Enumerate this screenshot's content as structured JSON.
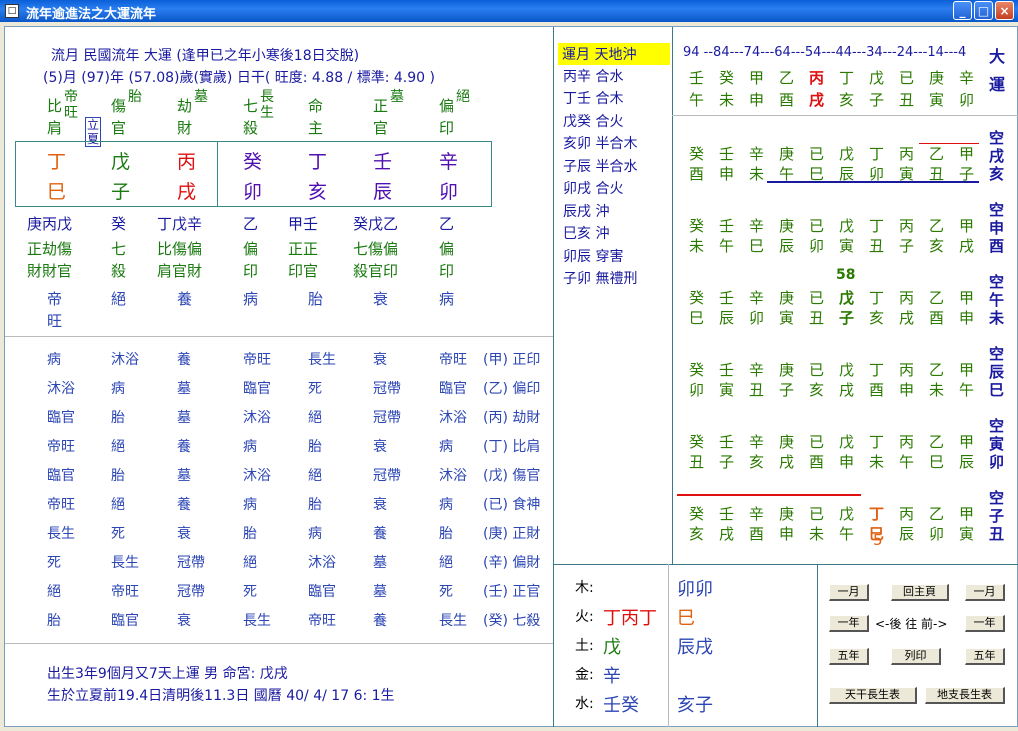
{
  "window": {
    "title": "流年逾進法之大運流年"
  },
  "header": {
    "line1": "流月  民國流年    大運   (逢甲已之年小寒後18日交脫)",
    "line2": "(5)月    (97)年    (57.08)歲(實歲)       日干( 旺度: 4.88 / 標準: 4.90 )"
  },
  "gods": [
    {
      "a": "比",
      "b": "肩",
      "c": "帝旺"
    },
    {
      "a": "傷",
      "b": "官",
      "c": "胎"
    },
    {
      "a": "劫",
      "b": "財",
      "c": "墓"
    },
    {
      "a": "七",
      "b": "殺",
      "c": "長生"
    },
    {
      "a": "命",
      "b": "主",
      "c": ""
    },
    {
      "a": "正",
      "b": "官",
      "c": "墓"
    },
    {
      "a": "偏",
      "b": "印",
      "c": "絕"
    }
  ],
  "lixia": "立夏",
  "stems": [
    "丁",
    "戊",
    "丙",
    "癸",
    "丁",
    "壬",
    "辛"
  ],
  "branches": [
    "巳",
    "子",
    "戌",
    "卯",
    "亥",
    "辰",
    "卯"
  ],
  "hidden_stems": [
    "庚丙戊",
    "癸",
    "丁戊辛",
    "乙",
    "甲壬",
    "癸戊乙",
    "乙"
  ],
  "hidden_gods": [
    {
      "l1": "正劫傷",
      "l2": "財財官"
    },
    {
      "l1": "七",
      "l2": "殺"
    },
    {
      "l1": "比傷偏",
      "l2": "肩官財"
    },
    {
      "l1": "偏",
      "l2": "印"
    },
    {
      "l1": "正正",
      "l2": "印官"
    },
    {
      "l1": "七傷偏",
      "l2": "殺官印"
    },
    {
      "l1": "偏",
      "l2": "印"
    }
  ],
  "life_stage": [
    {
      "l1": "帝",
      "l2": "旺"
    },
    {
      "l1": "絕",
      "l2": ""
    },
    {
      "l1": "養",
      "l2": ""
    },
    {
      "l1": "病",
      "l2": ""
    },
    {
      "l1": "胎",
      "l2": ""
    },
    {
      "l1": "衰",
      "l2": ""
    },
    {
      "l1": "病",
      "l2": ""
    }
  ],
  "stage_table": [
    {
      "cells": [
        "病",
        "沐浴",
        "養",
        "帝旺",
        "長生",
        "衰",
        "帝旺"
      ],
      "label": "(甲) 正印"
    },
    {
      "cells": [
        "沐浴",
        "病",
        "墓",
        "臨官",
        "死",
        "冠帶",
        "臨官"
      ],
      "label": "(乙) 偏印"
    },
    {
      "cells": [
        "臨官",
        "胎",
        "墓",
        "沐浴",
        "絕",
        "冠帶",
        "沐浴"
      ],
      "label": "(丙) 劫財"
    },
    {
      "cells": [
        "帝旺",
        "絕",
        "養",
        "病",
        "胎",
        "衰",
        "病"
      ],
      "label": "(丁) 比肩"
    },
    {
      "cells": [
        "臨官",
        "胎",
        "墓",
        "沐浴",
        "絕",
        "冠帶",
        "沐浴"
      ],
      "label": "(戊) 傷官"
    },
    {
      "cells": [
        "帝旺",
        "絕",
        "養",
        "病",
        "胎",
        "衰",
        "病"
      ],
      "label": "(已) 食神"
    },
    {
      "cells": [
        "長生",
        "死",
        "衰",
        "胎",
        "病",
        "養",
        "胎"
      ],
      "label": "(庚) 正財"
    },
    {
      "cells": [
        "死",
        "長生",
        "冠帶",
        "絕",
        "沐浴",
        "墓",
        "絕"
      ],
      "label": "(辛) 偏財"
    },
    {
      "cells": [
        "絕",
        "帝旺",
        "冠帶",
        "死",
        "臨官",
        "墓",
        "死"
      ],
      "label": "(壬) 正官"
    },
    {
      "cells": [
        "胎",
        "臨官",
        "衰",
        "長生",
        "帝旺",
        "養",
        "長生"
      ],
      "label": "(癸) 七殺"
    }
  ],
  "footer": {
    "l1": "出生3年9個月又7天上運          男    命宮: 戊戌",
    "l2": "生於立夏前19.4日清明後11.3日    國曆 40/ 4/ 17  6: 1生"
  },
  "relations": [
    "運月 天地沖",
    "丙辛 合水",
    "丁壬 合木",
    "戊癸 合火",
    "亥卯 半合木",
    "子辰 半合水",
    "卯戌 合火",
    "辰戌 沖",
    "巳亥 沖",
    "卯辰 穿害",
    "子卯 無禮刑"
  ],
  "luck_ages": "94 --84---74---64---54---44---34---24---14---4",
  "luck_stems": [
    "壬",
    "癸",
    "甲",
    "乙",
    "丙",
    "丁",
    "戊",
    "已",
    "庚",
    "辛"
  ],
  "luck_branches": [
    "午",
    "未",
    "申",
    "酉",
    "戌",
    "亥",
    "子",
    "丑",
    "寅",
    "卯"
  ],
  "dayun_label": "大運",
  "year_grid": [
    {
      "cells": [
        [
          "癸",
          "酉"
        ],
        [
          "壬",
          "申"
        ],
        [
          "辛",
          "未"
        ],
        [
          "庚",
          "午"
        ],
        [
          "已",
          "巳"
        ],
        [
          "戊",
          "辰"
        ],
        [
          "丁",
          "卯"
        ],
        [
          "丙",
          "寅"
        ],
        [
          "乙",
          "丑"
        ],
        [
          "甲",
          "子"
        ]
      ],
      "label": [
        "空",
        "戌",
        "亥"
      ]
    },
    {
      "cells": [
        [
          "癸",
          "未"
        ],
        [
          "壬",
          "午"
        ],
        [
          "辛",
          "巳"
        ],
        [
          "庚",
          "辰"
        ],
        [
          "已",
          "卯"
        ],
        [
          "戊",
          "寅"
        ],
        [
          "丁",
          "丑"
        ],
        [
          "丙",
          "子"
        ],
        [
          "乙",
          "亥"
        ],
        [
          "甲",
          "戌"
        ]
      ],
      "label": [
        "空",
        "申",
        "酉"
      ]
    },
    {
      "cells": [
        [
          "癸",
          "巳"
        ],
        [
          "壬",
          "辰"
        ],
        [
          "辛",
          "卯"
        ],
        [
          "庚",
          "寅"
        ],
        [
          "已",
          "丑"
        ],
        [
          "戊",
          "子"
        ],
        [
          "丁",
          "亥"
        ],
        [
          "丙",
          "戌"
        ],
        [
          "乙",
          "酉"
        ],
        [
          "甲",
          "申"
        ]
      ],
      "label": [
        "空",
        "午",
        "未"
      ]
    },
    {
      "cells": [
        [
          "癸",
          "卯"
        ],
        [
          "壬",
          "寅"
        ],
        [
          "辛",
          "丑"
        ],
        [
          "庚",
          "子"
        ],
        [
          "已",
          "亥"
        ],
        [
          "戊",
          "戌"
        ],
        [
          "丁",
          "酉"
        ],
        [
          "丙",
          "申"
        ],
        [
          "乙",
          "未"
        ],
        [
          "甲",
          "午"
        ]
      ],
      "label": [
        "空",
        "辰",
        "巳"
      ]
    },
    {
      "cells": [
        [
          "癸",
          "丑"
        ],
        [
          "壬",
          "子"
        ],
        [
          "辛",
          "亥"
        ],
        [
          "庚",
          "戌"
        ],
        [
          "已",
          "酉"
        ],
        [
          "戊",
          "申"
        ],
        [
          "丁",
          "未"
        ],
        [
          "丙",
          "午"
        ],
        [
          "乙",
          "巳"
        ],
        [
          "甲",
          "辰"
        ]
      ],
      "label": [
        "空",
        "寅",
        "卯"
      ]
    },
    {
      "cells": [
        [
          "癸",
          "亥"
        ],
        [
          "壬",
          "戌"
        ],
        [
          "辛",
          "酉"
        ],
        [
          "庚",
          "申"
        ],
        [
          "已",
          "未"
        ],
        [
          "戊",
          "午"
        ],
        [
          "丁",
          "巳"
        ],
        [
          "丙",
          "辰"
        ],
        [
          "乙",
          "卯"
        ],
        [
          "甲",
          "寅"
        ]
      ],
      "label": [
        "空",
        "子",
        "丑"
      ]
    }
  ],
  "marker_58": "58",
  "marker_5": "5",
  "elements": [
    {
      "name": "木:",
      "stems": "",
      "branches": "卯卯"
    },
    {
      "name": "火:",
      "stems": "丁丙丁",
      "branches": "巳"
    },
    {
      "name": "土:",
      "stems": "戊",
      "branches": "辰戌"
    },
    {
      "name": "金:",
      "stems": "辛",
      "branches": ""
    },
    {
      "name": "水:",
      "stems": "壬癸",
      "branches": "亥子"
    }
  ],
  "buttons": {
    "month_prev": "一月",
    "home": "回主頁",
    "month_next": "一月",
    "year_prev": "一年",
    "direction": "<-後  往  前->",
    "year_next": "一年",
    "five_prev": "五年",
    "print": "列印",
    "five_next": "五年",
    "tiangan_table": "天干長生表",
    "dizhi_table": "地支長生表"
  }
}
